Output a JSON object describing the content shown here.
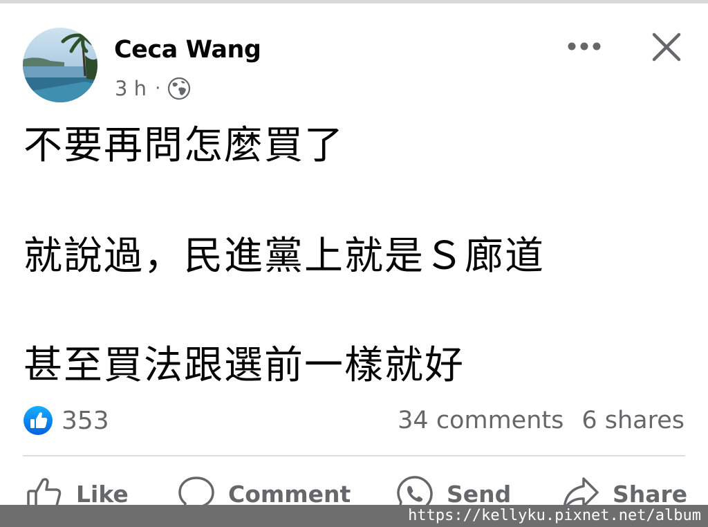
{
  "post": {
    "author": "Ceca Wang",
    "timestamp": "3 h",
    "separator": "·",
    "privacy_icon": "globe-icon",
    "lines": [
      "不要再問怎麼買了",
      "就說過，民進黨上就是Ｓ廊道",
      "甚至買法跟選前一樣就好"
    ]
  },
  "stats": {
    "reaction_icon": "like-reaction-icon",
    "likes": "353",
    "comments": "34 comments",
    "shares": "6 shares"
  },
  "actions": {
    "like": "Like",
    "comment": "Comment",
    "send": "Send",
    "share": "Share"
  },
  "watermark": "https://kellyku.pixnet.net/album",
  "colors": {
    "accent": "#1877f2",
    "secondary_text": "#65676b",
    "primary_text": "#050505",
    "divider": "#dadde1"
  }
}
